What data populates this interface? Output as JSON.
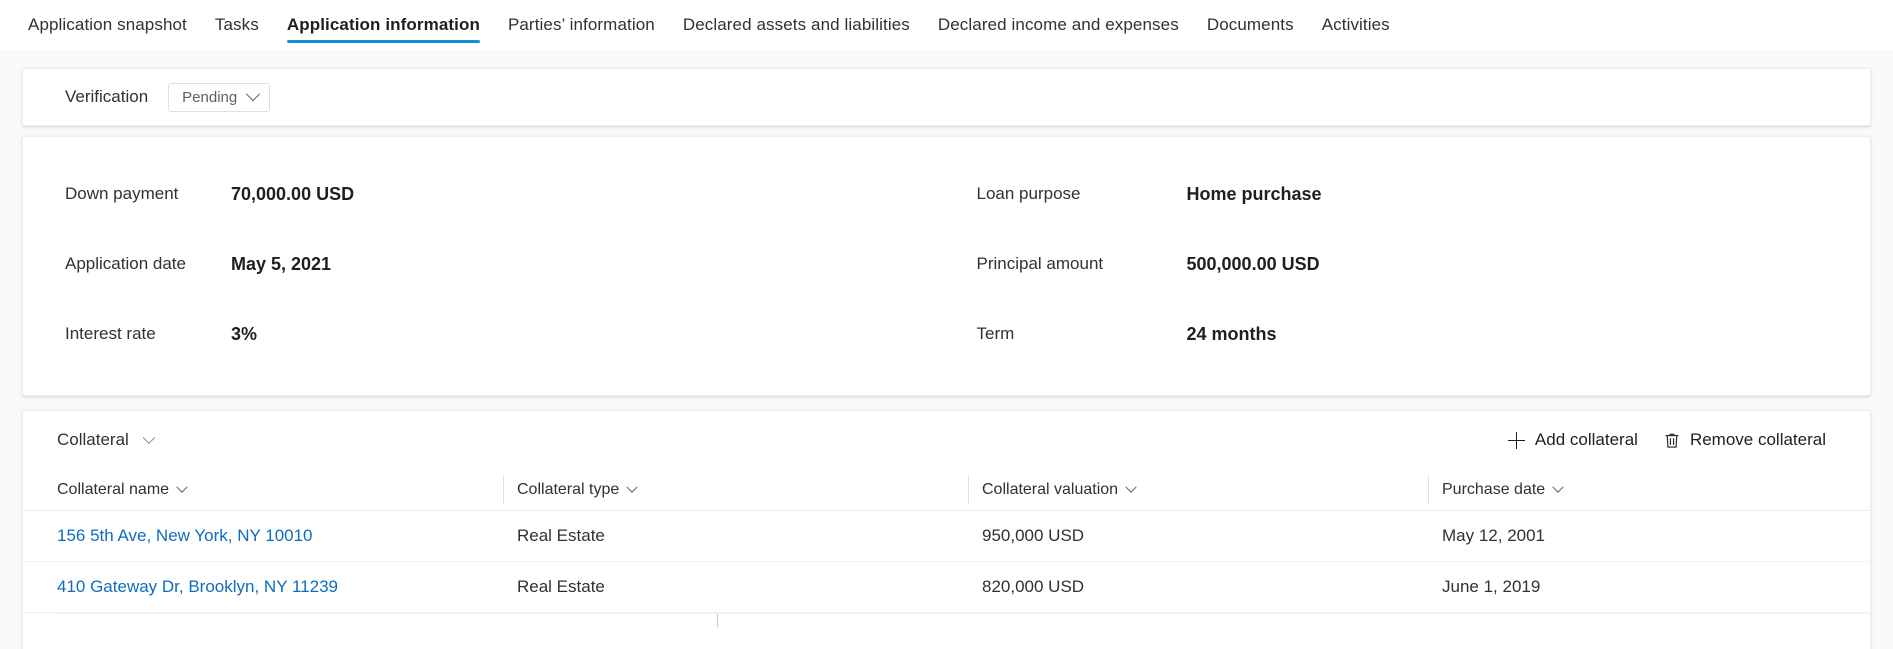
{
  "tabs": [
    {
      "label": "Application snapshot",
      "active": false
    },
    {
      "label": "Tasks",
      "active": false
    },
    {
      "label": "Application information",
      "active": true
    },
    {
      "label": "Parties’ information",
      "active": false
    },
    {
      "label": "Declared assets and liabilities",
      "active": false
    },
    {
      "label": "Declared income and expenses",
      "active": false
    },
    {
      "label": "Documents",
      "active": false
    },
    {
      "label": "Activities",
      "active": false
    }
  ],
  "verification": {
    "label": "Verification",
    "status_value": "Pending"
  },
  "details": {
    "rows": [
      {
        "left_label": "Down payment",
        "left_value": "70,000.00 USD",
        "right_label": "Loan purpose",
        "right_value": "Home purchase"
      },
      {
        "left_label": "Application date",
        "left_value": "May 5, 2021",
        "right_label": "Principal amount",
        "right_value": "500,000.00 USD"
      },
      {
        "left_label": "Interest rate",
        "left_value": "3%",
        "right_label": "Term",
        "right_value": "24 months"
      }
    ]
  },
  "collateral": {
    "title": "Collateral",
    "commands": {
      "add_label": "Add  collateral",
      "remove_label": "Remove collateral"
    },
    "columns": [
      "Collateral name",
      "Collateral type",
      "Collateral valuation",
      "Purchase date"
    ],
    "rows": [
      {
        "name": "156 5th Ave, New York, NY 10010",
        "type": "Real Estate",
        "valuation": "950,000 USD",
        "purchase_date": "May 12, 2001"
      },
      {
        "name": "410 Gateway Dr, Brooklyn, NY 11239",
        "type": "Real Estate",
        "valuation": "820,000 USD",
        "purchase_date": "June 1, 2019"
      }
    ]
  },
  "colors": {
    "accent": "#1590d8",
    "link": "#0f6cbd",
    "text": "#323130",
    "surface": "#ffffff",
    "canvas": "#faf9f8"
  }
}
